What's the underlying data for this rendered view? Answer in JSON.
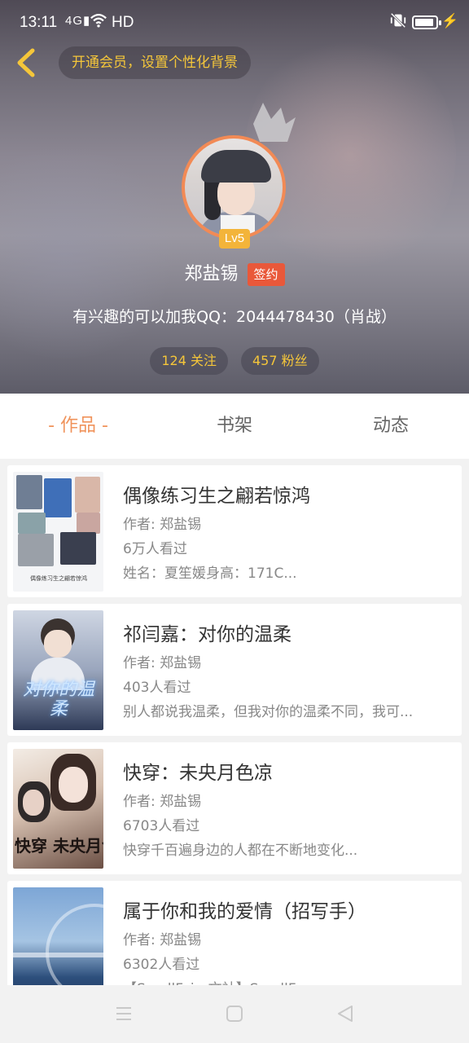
{
  "status_bar": {
    "time": "13:11",
    "signal": "4G",
    "hd": "HD",
    "icons": [
      "wifi-icon",
      "vibrate-off-icon",
      "battery-icon",
      "charging-icon"
    ]
  },
  "header": {
    "back_icon": "chevron-left-icon",
    "vip_prompt": "开通会员，设置个性化背景"
  },
  "profile": {
    "level": "Lv5",
    "name": "郑盐锡",
    "badge": "签约",
    "bio": "有兴趣的可以加我QQ：2044478430（肖战）",
    "following": "124 关注",
    "followers": "457 粉丝"
  },
  "tabs": [
    {
      "label": "- 作品 -",
      "active": true
    },
    {
      "label": "书架",
      "active": false
    },
    {
      "label": "动态",
      "active": false
    }
  ],
  "books": [
    {
      "title": "偶像练习生之翩若惊鸿",
      "author": "作者: 郑盐锡",
      "views": "6万人看过",
      "desc": "姓名：夏笙媛身高：171C..."
    },
    {
      "title": "祁闫嘉：对你的温柔",
      "author": "作者: 郑盐锡",
      "views": "403人看过",
      "desc": "别人都说我温柔，但我对你的温柔不同，我可..."
    },
    {
      "title": "快穿：未央月色凉",
      "author": "作者: 郑盐锡",
      "views": "6703人看过",
      "desc": "快穿千百遍身边的人都在不断地变化..."
    },
    {
      "title": "属于你和我的爱情（招写手）",
      "author": "作者: 郑盐锡",
      "views": "6302人看过",
      "desc": "【SmallFairy文社】SmallF..."
    }
  ],
  "cover_text": {
    "book1": "偶像练习生之翩若惊鸿",
    "book2": "对你的温柔",
    "book3": "快穿 未央月色凉"
  },
  "colors": {
    "accent": "#f0935b",
    "gold": "#f5c63a",
    "badge": "#e9583a",
    "avatar_ring": "#f28a55"
  }
}
